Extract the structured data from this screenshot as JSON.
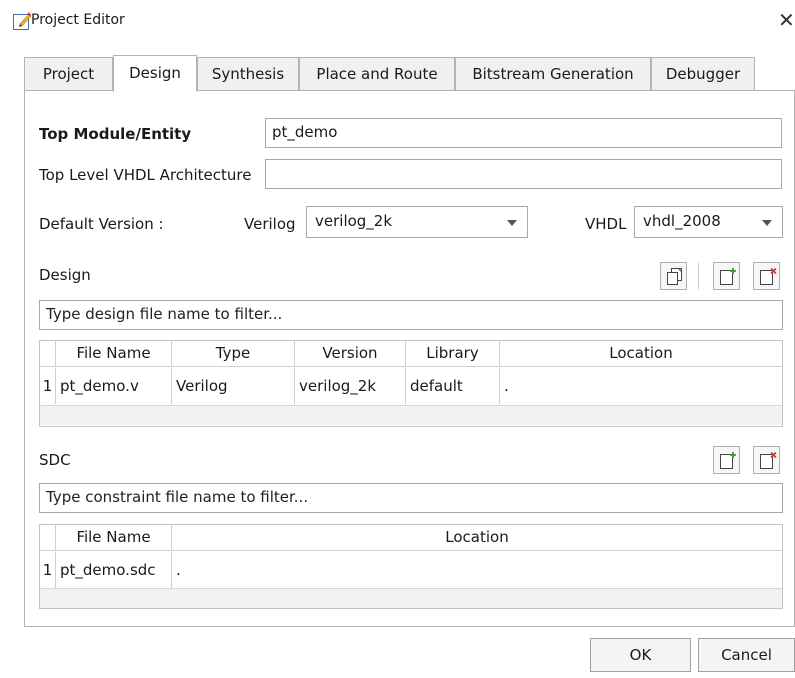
{
  "window": {
    "title": "Project Editor",
    "close_glyph": "✕"
  },
  "tabs": [
    {
      "label": "Project",
      "active": false
    },
    {
      "label": "Design",
      "active": true
    },
    {
      "label": "Synthesis",
      "active": false
    },
    {
      "label": "Place and Route",
      "active": false
    },
    {
      "label": "Bitstream Generation",
      "active": false
    },
    {
      "label": "Debugger",
      "active": false
    }
  ],
  "design_tab": {
    "top_module_label": "Top Module/Entity",
    "top_module_value": "pt_demo",
    "vhdl_arch_label": "Top Level VHDL Architecture",
    "vhdl_arch_value": "",
    "default_version_label": "Default Version :",
    "verilog_label": "Verilog",
    "verilog_value": "verilog_2k",
    "vhdl_label": "VHDL",
    "vhdl_value": "vhdl_2008",
    "design_section_label": "Design",
    "design_filter_placeholder": "Type design file name to filter...",
    "design_table": {
      "columns": [
        "File Name",
        "Type",
        "Version",
        "Library",
        "Location"
      ],
      "rows": [
        {
          "num": "1",
          "cells": [
            "pt_demo.v",
            "Verilog",
            "verilog_2k",
            "default",
            "."
          ]
        }
      ]
    },
    "sdc_section_label": "SDC",
    "sdc_filter_placeholder": "Type constraint file name to filter...",
    "sdc_table": {
      "columns": [
        "File Name",
        "Location"
      ],
      "rows": [
        {
          "num": "1",
          "cells": [
            "pt_demo.sdc",
            "."
          ]
        }
      ]
    }
  },
  "icons": {
    "design_toolbar": [
      "copy-icon",
      "add-file-icon",
      "remove-file-icon"
    ],
    "sdc_toolbar": [
      "add-file-icon",
      "remove-file-icon"
    ]
  },
  "colors": {
    "add_green": "#2e9b3a",
    "remove_red": "#d03030",
    "border": "#b4b4b4"
  },
  "buttons": {
    "ok": "OK",
    "cancel": "Cancel"
  }
}
